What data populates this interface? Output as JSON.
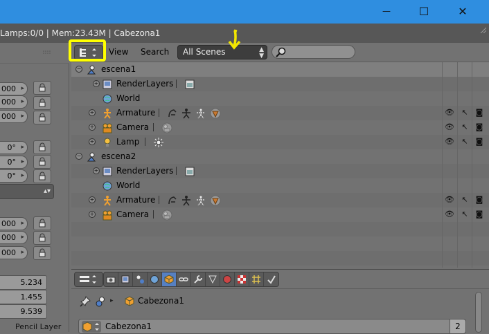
{
  "window": {
    "controls": {
      "minimize": "—",
      "maximize": "☐",
      "close": "✕"
    }
  },
  "infobar": {
    "text": "Lamps:0/0 | Mem:23.43M | Cabezona1"
  },
  "left_panel": {
    "fields_top": [
      "000",
      "000",
      "000"
    ],
    "fields_rot": [
      "0°",
      "0°",
      "0°"
    ],
    "fields_scale": [
      "000",
      "000",
      "000"
    ],
    "dimensions": [
      "5.234",
      "1.455",
      "9.539"
    ],
    "bottom_label": "Pencil Layer"
  },
  "outliner": {
    "menu": {
      "view": "View",
      "search": "Search"
    },
    "scene_filter": {
      "value": "All Scenes"
    },
    "search": {
      "placeholder": ""
    },
    "tree": [
      {
        "label": "escena1",
        "icon": "scene-icon",
        "level": 0,
        "expander": "−"
      },
      {
        "label": "RenderLayers",
        "icon": "renderlayers-icon",
        "level": 1,
        "expander": "+"
      },
      {
        "label": "World",
        "icon": "world-icon",
        "level": 1,
        "expander": ""
      },
      {
        "label": "Armature",
        "icon": "armature-icon",
        "level": 1,
        "expander": "+"
      },
      {
        "label": "Camera",
        "icon": "camera-icon",
        "level": 1,
        "expander": "+"
      },
      {
        "label": "Lamp",
        "icon": "lamp-icon",
        "level": 1,
        "expander": "+"
      },
      {
        "label": "escena2",
        "icon": "scene-icon",
        "level": 0,
        "expander": "−"
      },
      {
        "label": "RenderLayers",
        "icon": "renderlayers-icon",
        "level": 1,
        "expander": "+"
      },
      {
        "label": "World",
        "icon": "world-icon",
        "level": 1,
        "expander": ""
      },
      {
        "label": "Armature",
        "icon": "armature-icon",
        "level": 1,
        "expander": "+"
      },
      {
        "label": "Camera",
        "icon": "camera-icon",
        "level": 1,
        "expander": "+"
      }
    ]
  },
  "properties": {
    "breadcrumb_object": "Cabezona1",
    "name_field": "Cabezona1",
    "user_count": "2"
  },
  "colors": {
    "titlebar": "#2f8ee0",
    "highlight": "#ffff00",
    "arrow": "#f2e600",
    "active_context": "#5680c2"
  }
}
